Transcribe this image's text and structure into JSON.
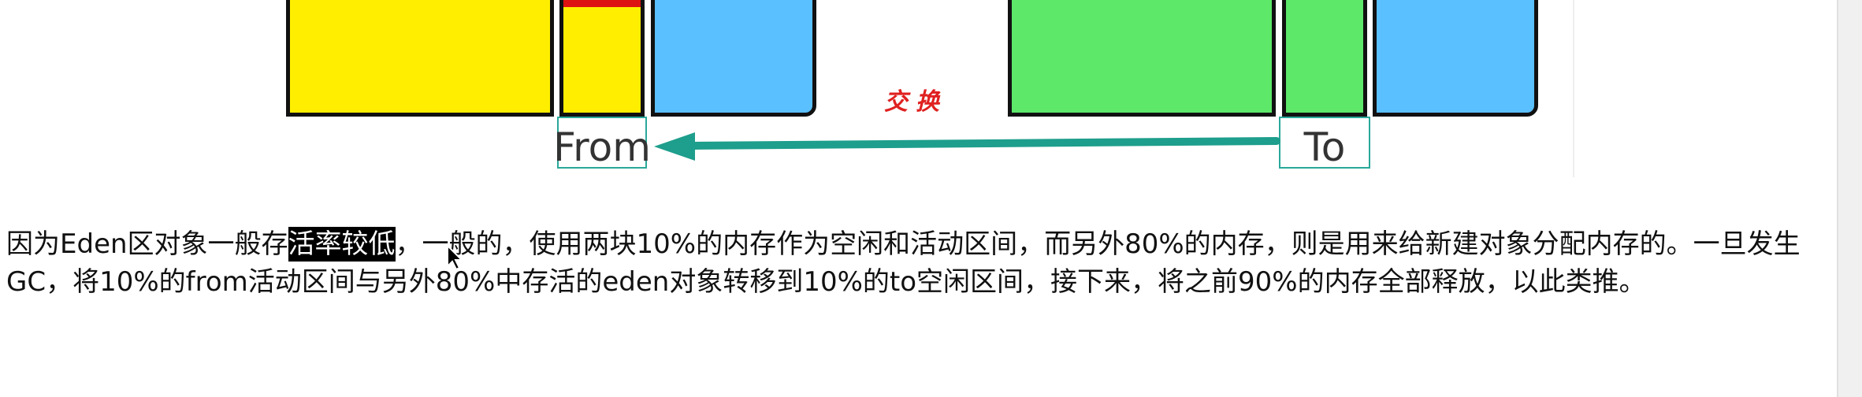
{
  "figure": {
    "arrow_label": "交换",
    "from_label": "From",
    "to_label": "To",
    "colors": {
      "eden_yellow": "#ffee00",
      "survivor_blue": "#5bc0ff",
      "old_green": "#5de86a",
      "marker_red": "#dd1111",
      "arrow_teal": "#1e9e8c"
    }
  },
  "paragraph": {
    "part1": "因为Eden区对象一般存",
    "highlighted": "活率较低",
    "part2": "，一般的，使用两块10%的内存作为空闲和活动区间，而另外80%的内存，则是用来给新建对象分配内存的。一旦发生GC，将10%的from活动区间与另外80%中存活的eden对象转移到10%的to空闲区间，接下来，将之前90%的内存全部释放，以此类推。"
  }
}
